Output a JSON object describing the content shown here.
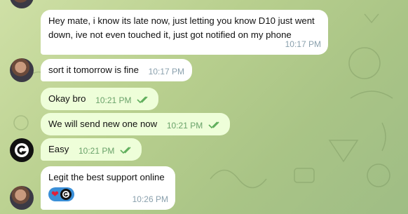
{
  "messages": [
    {
      "text": "Hey mate, i know its late now, just letting you know D10 just went down, ive not even touched it, just got notified on my phone",
      "time": "10:17 PM"
    },
    {
      "text": "sort it tomorrow is fine",
      "time": "10:17 PM"
    },
    {
      "text": "Okay bro",
      "time": "10:21 PM",
      "status": "read"
    },
    {
      "text": "We will send new one now",
      "time": "10:21 PM",
      "status": "read"
    },
    {
      "text": "Easy",
      "time": "10:21 PM",
      "status": "read"
    },
    {
      "text": "Legit the best support online",
      "time": "10:26 PM",
      "reactions": [
        "heart",
        "brand-logo"
      ]
    }
  ],
  "colors": {
    "incoming": "#ffffff",
    "outgoing": "#eefed9",
    "check": "#5fae5c",
    "reaction_pill": "#3a8fd8"
  }
}
